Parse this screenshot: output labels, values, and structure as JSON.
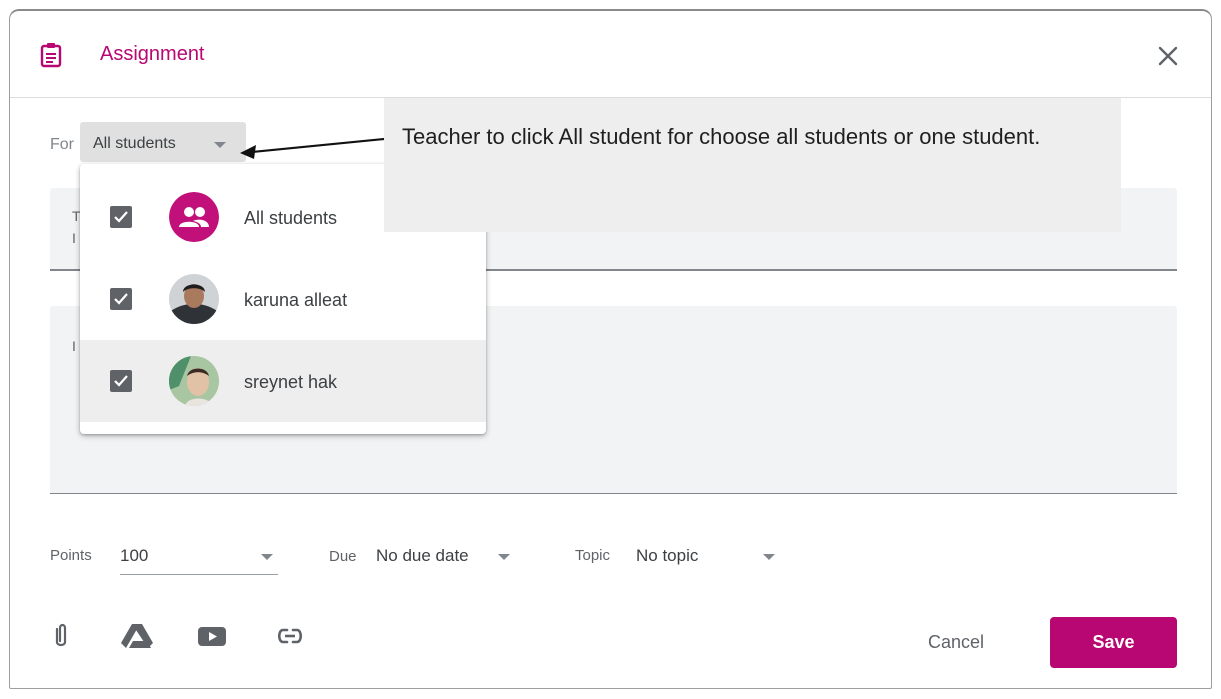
{
  "header": {
    "title": "Assignment",
    "icon": "assignment-icon",
    "close_icon": "close-icon",
    "accent_color": "#b80672"
  },
  "for_field": {
    "label": "For",
    "selected": "All students"
  },
  "background_fields": {
    "title_ghost_line1": "T",
    "title_ghost_line2": "I",
    "instructions_ghost": "I"
  },
  "student_menu": {
    "items": [
      {
        "name": "All students",
        "checked": true,
        "avatar": "group-icon"
      },
      {
        "name": "karuna alleat",
        "checked": true,
        "avatar": "user-photo"
      },
      {
        "name": "sreynet hak",
        "checked": true,
        "avatar": "user-photo",
        "highlighted": true
      }
    ]
  },
  "annotation": {
    "text": "Teacher to click All student for choose all students or one student."
  },
  "meta": {
    "points_label": "Points",
    "points_value": "100",
    "due_label": "Due",
    "due_value": "No due date",
    "topic_label": "Topic",
    "topic_value": "No topic"
  },
  "attachments": [
    "paperclip-icon",
    "google-drive-icon",
    "youtube-icon",
    "link-icon"
  ],
  "actions": {
    "cancel_label": "Cancel",
    "save_label": "Save"
  }
}
